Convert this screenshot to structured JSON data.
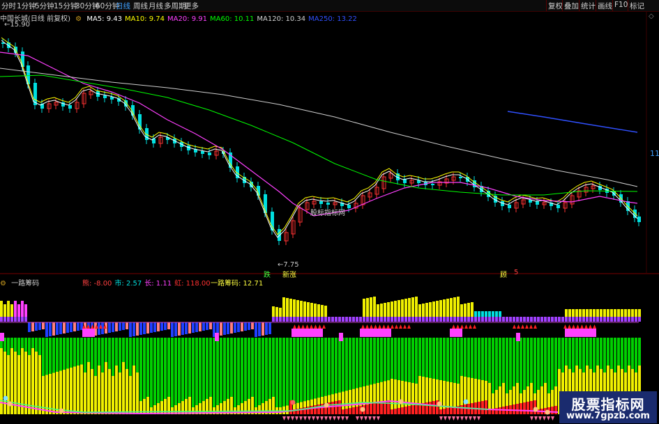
{
  "toolbar": {
    "left_tabs": [
      "分时",
      "1分钟",
      "5分钟",
      "15分钟",
      "30分钟",
      "60分钟",
      "日线",
      "周线",
      "月线",
      "多周期",
      "更多"
    ],
    "active_tab": "日线",
    "right_tabs": [
      "复权",
      "叠加",
      "统计",
      "画线",
      "F10",
      "标记"
    ]
  },
  "main_legend": {
    "title": "中国长城(日线 前复权)",
    "ma": [
      {
        "label": "MA5: 9.43",
        "color": "#ffffff"
      },
      {
        "label": "MA10: 9.74",
        "color": "#ffff00"
      },
      {
        "label": "MA20: 9.91",
        "color": "#ff40ff"
      },
      {
        "label": "MA60: 10.11",
        "color": "#00ff00"
      },
      {
        "label": "MA120: 10.34",
        "color": "#d0d0d0"
      },
      {
        "label": "MA250: 13.22",
        "color": "#3050ff"
      }
    ]
  },
  "annotations": {
    "high_price": "15.90",
    "low_price": "7.75",
    "right_axis": "11",
    "chart_note": "股标指标网",
    "signal_1": "跌",
    "signal_2": "新涨",
    "signal_3": "顾",
    "signal_4": "5"
  },
  "sub_legend": {
    "title": "一路筹码",
    "items": [
      {
        "label": "熊: -8.00",
        "color": "#ff4040"
      },
      {
        "label": "市: 2.57",
        "color": "#00e0e0"
      },
      {
        "label": "长: 1.11",
        "color": "#ff40ff"
      },
      {
        "label": "虹: 118.00",
        "color": "#ff3030"
      }
    ],
    "value_label": "一路筹码: 12.71"
  },
  "watermark": {
    "line1": "股票指标网",
    "line2": "www.7gpzb.com"
  },
  "colors": {
    "up": "#ff3232",
    "down": "#00e0e0",
    "ma5": "#ffffff",
    "ma10": "#ffff00",
    "ma20": "#ff40ff",
    "ma60": "#00ff00",
    "ma120": "#d0d0d0",
    "ma250": "#3050ff",
    "green_area": "#00d000",
    "yellow_area": "#f0f000",
    "red_area": "#ff2020",
    "magenta_area": "#ff40ff"
  }
}
